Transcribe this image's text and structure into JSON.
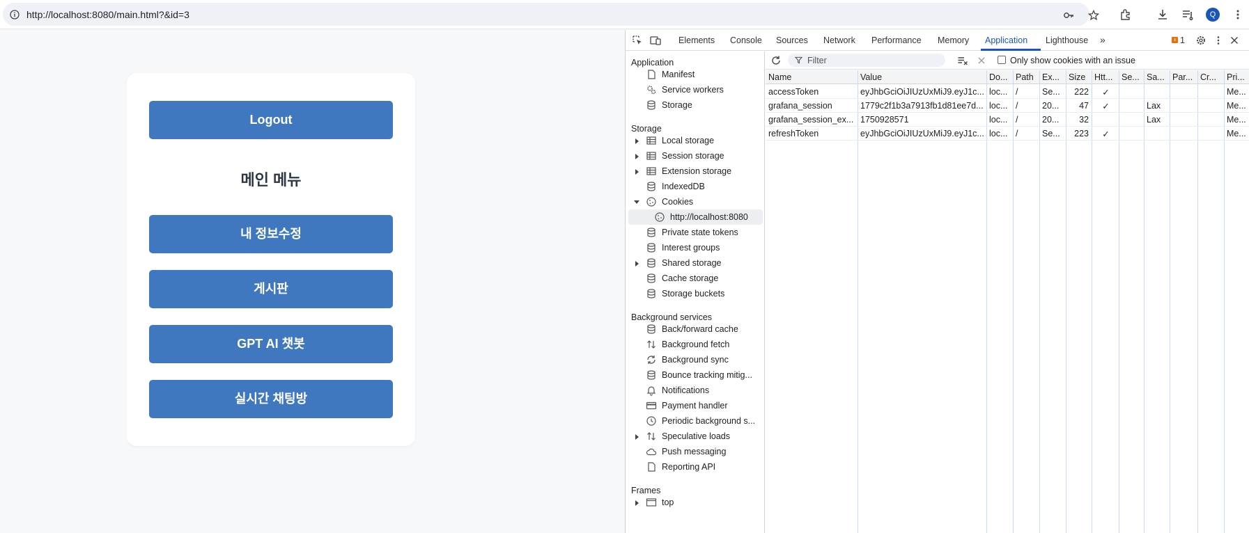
{
  "browser": {
    "url": "http://localhost:8080/main.html?&id=3",
    "profile_initial": "Q"
  },
  "page": {
    "logout_label": "Logout",
    "menu_title": "메인 메뉴",
    "buttons": [
      "내 정보수정",
      "게시판",
      "GPT AI 챗봇",
      "실시간 채팅방"
    ]
  },
  "devtools": {
    "tabs": [
      "Elements",
      "Console",
      "Sources",
      "Network",
      "Performance",
      "Memory",
      "Application",
      "Lighthouse"
    ],
    "active_tab": "Application",
    "issues_count": "1",
    "sidebar": {
      "application_header": "Application",
      "application_items": [
        "Manifest",
        "Service workers",
        "Storage"
      ],
      "storage_header": "Storage",
      "storage_items": [
        "Local storage",
        "Session storage",
        "Extension storage",
        "IndexedDB",
        "Cookies",
        "http://localhost:8080",
        "Private state tokens",
        "Interest groups",
        "Shared storage",
        "Cache storage",
        "Storage buckets"
      ],
      "background_header": "Background services",
      "background_items": [
        "Back/forward cache",
        "Background fetch",
        "Background sync",
        "Bounce tracking mitig...",
        "Notifications",
        "Payment handler",
        "Periodic background s...",
        "Speculative loads",
        "Push messaging",
        "Reporting API"
      ],
      "frames_header": "Frames",
      "frames_items": [
        "top"
      ]
    },
    "filter": {
      "placeholder": "Filter",
      "only_issues_label": "Only show cookies with an issue"
    },
    "cookie_table": {
      "columns": [
        "Name",
        "Value",
        "Do...",
        "Path",
        "Ex...",
        "Size",
        "Htt...",
        "Se...",
        "Sa...",
        "Par...",
        "Cr...",
        "Pri..."
      ],
      "rows": [
        [
          "accessToken",
          "eyJhbGciOiJIUzUxMiJ9.eyJ1c...",
          "loc...",
          "/",
          "Se...",
          "222",
          "✓",
          "",
          "",
          "",
          "",
          "Me..."
        ],
        [
          "grafana_session",
          "1779c2f1b3a7913fb1d81ee7d...",
          "loc...",
          "/",
          "20...",
          "47",
          "✓",
          "",
          "Lax",
          "",
          "",
          "Me..."
        ],
        [
          "grafana_session_ex...",
          "1750928571",
          "loc...",
          "/",
          "20...",
          "32",
          "",
          "",
          "Lax",
          "",
          "",
          "Me..."
        ],
        [
          "refreshToken",
          "eyJhbGciOiJIUzUxMiJ9.eyJ1c...",
          "loc...",
          "/",
          "Se...",
          "223",
          "✓",
          "",
          "",
          "",
          "",
          "Me..."
        ]
      ]
    }
  }
}
